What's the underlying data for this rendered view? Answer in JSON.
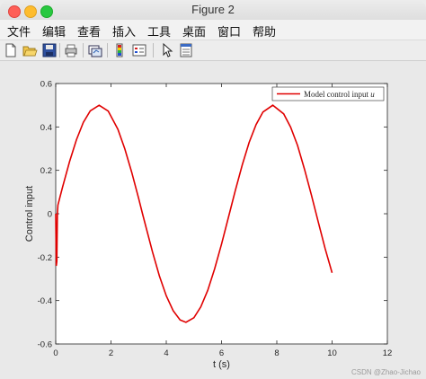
{
  "window": {
    "title": "Figure 2"
  },
  "menu": [
    "文件",
    "编辑",
    "查看",
    "插入",
    "工具",
    "桌面",
    "窗口",
    "帮助"
  ],
  "toolbar": {
    "icons": [
      "new-figure-icon",
      "open-file-icon",
      "save-icon",
      "print-icon",
      "link-plot-icon",
      "insert-colorbar-icon",
      "insert-legend-icon",
      "pointer-icon",
      "property-inspector-icon"
    ]
  },
  "watermark": "CSDN @Zhao-Jichao",
  "colors": {
    "line": "#e00000",
    "axes_bg": "#ffffff",
    "figure_bg": "#e9e9e9"
  },
  "chart_data": {
    "type": "line",
    "title": "",
    "xlabel": "t (s)",
    "ylabel": "Control input",
    "xlim": [
      0,
      12
    ],
    "ylim": [
      -0.6,
      0.6
    ],
    "xticks": [
      0,
      2,
      4,
      6,
      8,
      10,
      12
    ],
    "yticks": [
      -0.6,
      -0.4,
      -0.2,
      0,
      0.2,
      0.4,
      0.6
    ],
    "xtick_labels": [
      "0",
      "2",
      "4",
      "6",
      "8",
      "10",
      "12"
    ],
    "ytick_labels": [
      "-0.6",
      "-0.4",
      "-0.2",
      "0",
      "0.2",
      "0.4",
      "0.6"
    ],
    "grid": false,
    "legend": {
      "location": "top-right",
      "entries": [
        {
          "label": "Model control input",
          "math": "u"
        }
      ]
    },
    "series": [
      {
        "name": "Model control input u",
        "color": "#e00000",
        "x": [
          0,
          0.02,
          0.04,
          0.06,
          0.08,
          0.1,
          0.15,
          0.25,
          0.5,
          0.75,
          1.0,
          1.25,
          1.571,
          1.9,
          2.25,
          2.5,
          2.75,
          3.0,
          3.14,
          3.5,
          3.75,
          4.0,
          4.25,
          4.5,
          4.712,
          5.0,
          5.25,
          5.5,
          5.75,
          6.0,
          6.283,
          6.5,
          6.75,
          7.0,
          7.25,
          7.5,
          7.854,
          8.25,
          8.5,
          8.75,
          9.0,
          9.25,
          9.5,
          9.75,
          10.0
        ],
        "y": [
          0.0,
          -0.24,
          -0.22,
          0.0,
          0.04,
          0.05,
          0.075,
          0.124,
          0.24,
          0.341,
          0.421,
          0.474,
          0.5,
          0.473,
          0.389,
          0.299,
          0.191,
          0.071,
          0.0,
          -0.175,
          -0.286,
          -0.378,
          -0.447,
          -0.489,
          -0.5,
          -0.479,
          -0.429,
          -0.353,
          -0.254,
          -0.14,
          0.0,
          0.108,
          0.225,
          0.329,
          0.411,
          0.469,
          0.5,
          0.46,
          0.399,
          0.315,
          0.206,
          0.087,
          -0.038,
          -0.161,
          -0.272
        ]
      }
    ]
  }
}
